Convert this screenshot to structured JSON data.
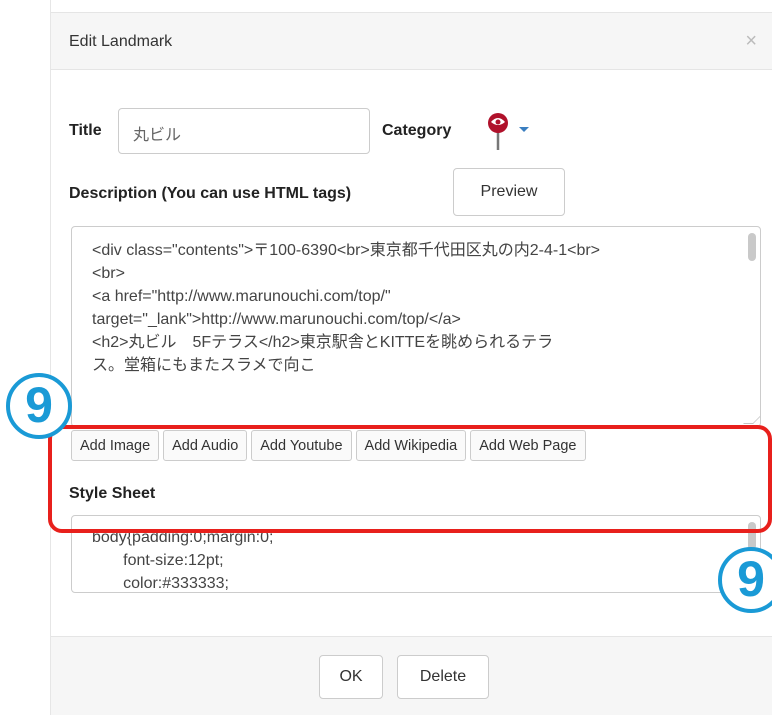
{
  "dialog": {
    "title": "Edit Landmark",
    "close_symbol": "×"
  },
  "form": {
    "title_label": "Title",
    "title_value": "丸ビル",
    "category_label": "Category",
    "category_icon": "map-pin-icon",
    "description_label": "Description (You can use HTML tags)",
    "preview_label": "Preview",
    "description_text": "<div class=\"contents\">〒100-6390<br>東京都千代田区丸の内2-4-1<br>\n<br>\n<a href=\"http://www.marunouchi.com/top/\"\ntarget=\"_lank\">http://www.marunouchi.com/top/</a>\n<h2>丸ビル　5Fテラス</h2>東京駅舎とKITTEを眺められるテラ\nス。堂箱にもまたスラメで向こ",
    "add_buttons": [
      "Add Image",
      "Add Audio",
      "Add Youtube",
      "Add Wikipedia",
      "Add Web Page"
    ],
    "style_sheet_label": "Style Sheet",
    "style_sheet_text": "body{padding:0;margin:0;\n       font-size:12pt;\n       color:#333333;"
  },
  "footer": {
    "ok_label": "OK",
    "delete_label": "Delete"
  },
  "annotation": {
    "step_number": "9",
    "highlight_color": "#e8201c",
    "badge_color": "#1a9ad6"
  }
}
